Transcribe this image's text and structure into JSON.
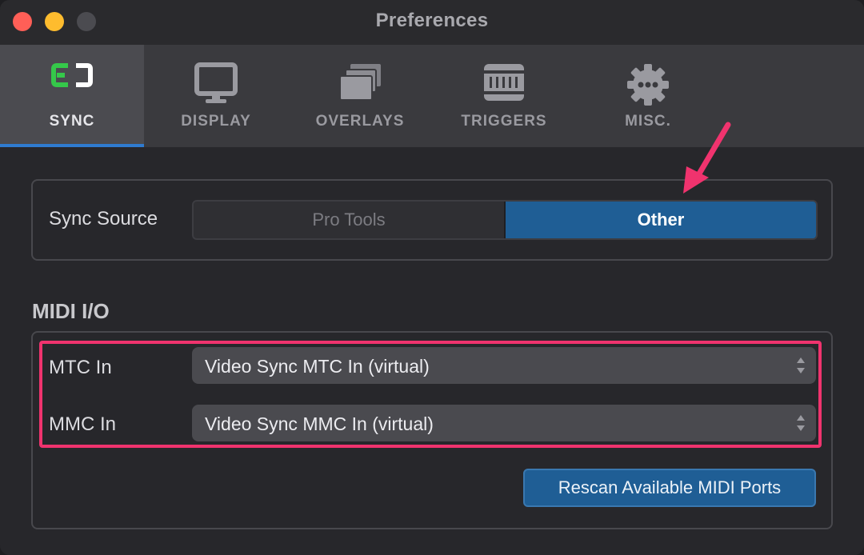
{
  "window": {
    "title": "Preferences"
  },
  "tabs": [
    {
      "label": "SYNC",
      "icon": "sync-icon",
      "active": true
    },
    {
      "label": "DISPLAY",
      "icon": "display-icon",
      "active": false
    },
    {
      "label": "OVERLAYS",
      "icon": "overlays-icon",
      "active": false
    },
    {
      "label": "TRIGGERS",
      "icon": "midi-icon",
      "active": false
    },
    {
      "label": "MISC.",
      "icon": "gear-icon",
      "active": false
    }
  ],
  "sync": {
    "label": "Sync Source",
    "options": [
      "Pro Tools",
      "Other"
    ],
    "selected": "Other"
  },
  "midi": {
    "section_title": "MIDI I/O",
    "mtc_label": "MTC In",
    "mtc_value": "Video Sync MTC In (virtual)",
    "mmc_label": "MMC In",
    "mmc_value": "Video Sync MMC In (virtual)",
    "rescan_label": "Rescan Available MIDI Ports"
  },
  "colors": {
    "accent": "#1f5e95",
    "annotation": "#f0336e",
    "sync_icon_green": "#35c84a"
  }
}
